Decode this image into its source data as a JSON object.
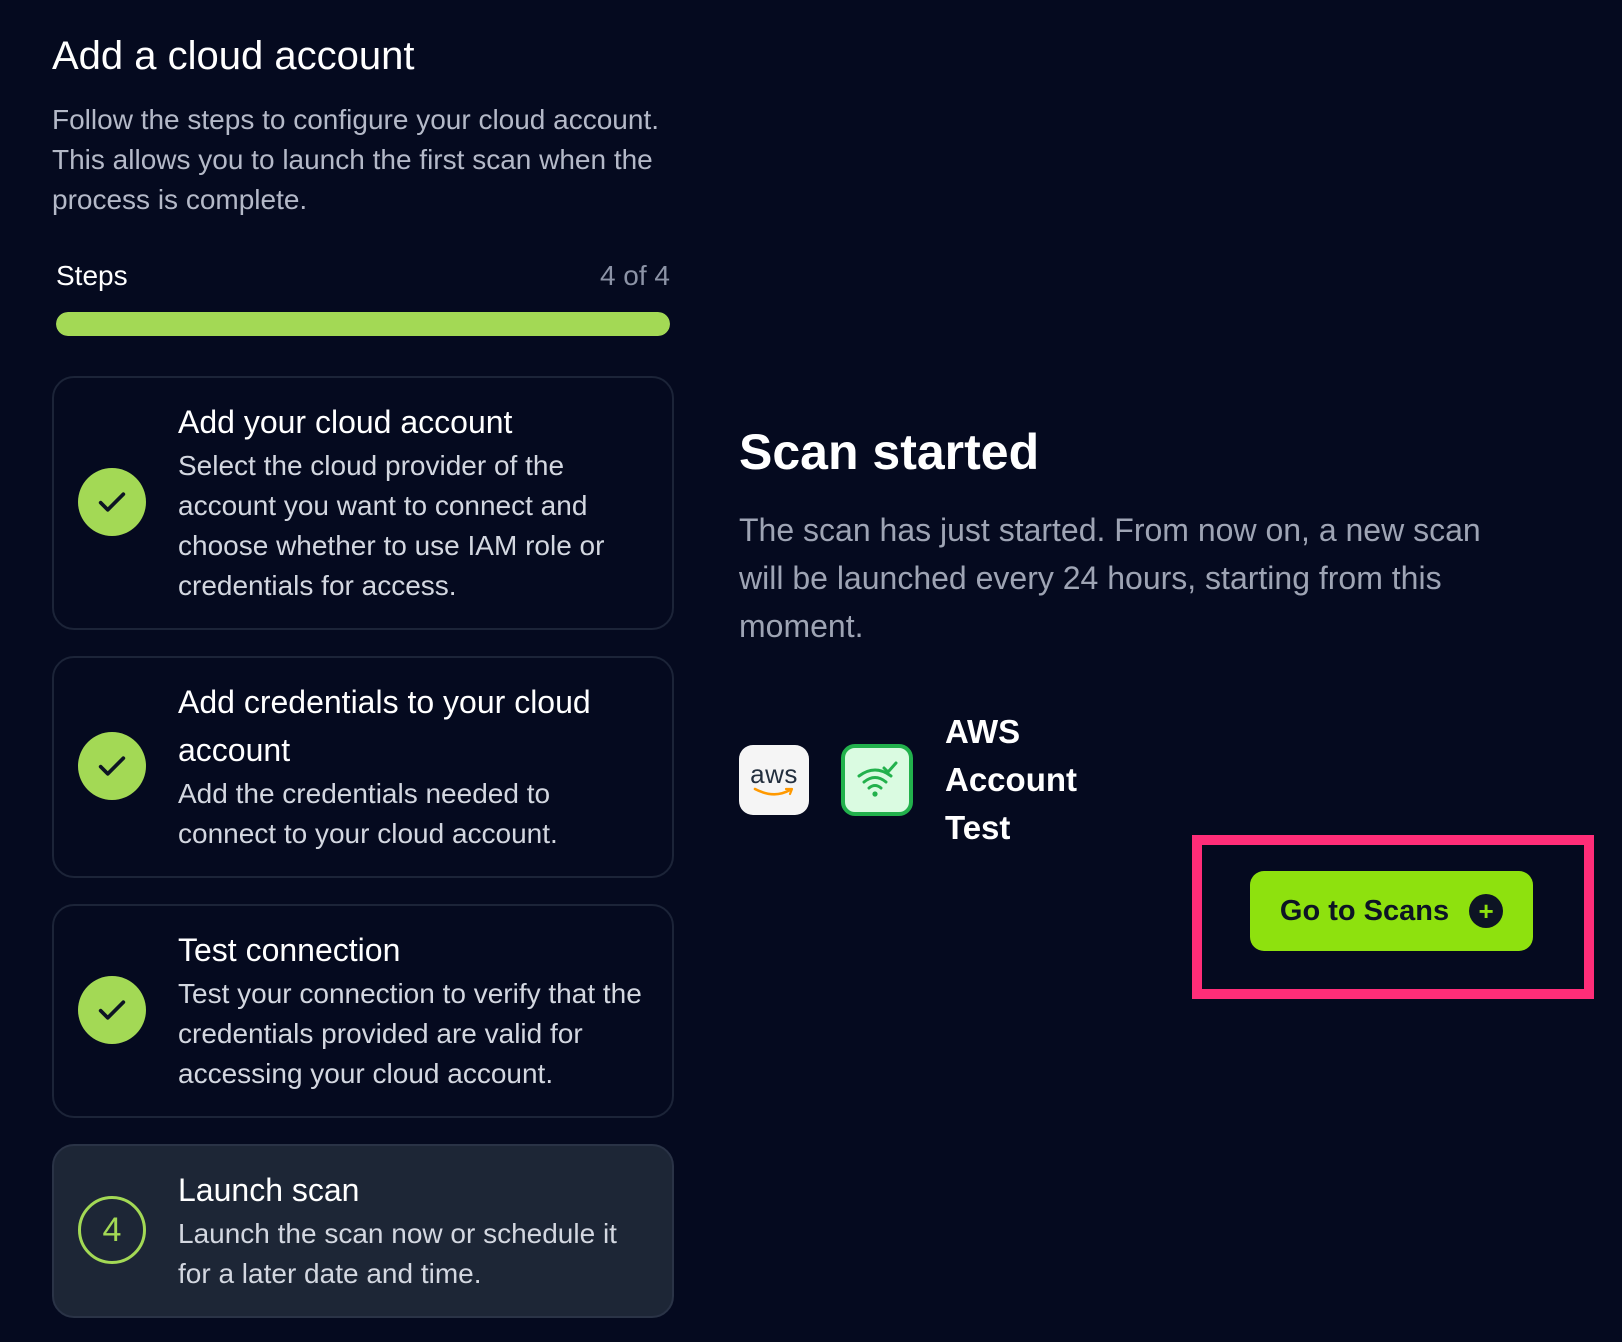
{
  "header": {
    "title": "Add a cloud account",
    "subtitle": "Follow the steps to configure your cloud account. This allows you to launch the first scan when the process is complete."
  },
  "progress": {
    "label": "Steps",
    "count_text": "4 of 4",
    "current": 4,
    "total": 4,
    "fraction": 1.0,
    "color": "#a3d955"
  },
  "steps": [
    {
      "status": "done",
      "icon": "check-icon",
      "title": "Add your cloud account",
      "description": "Select the cloud provider of the account you want to connect and choose whether to use IAM role or credentials for access."
    },
    {
      "status": "done",
      "icon": "check-icon",
      "title": "Add credentials to your cloud account",
      "description": "Add the credentials needed to connect to your cloud account."
    },
    {
      "status": "done",
      "icon": "check-icon",
      "title": "Test connection",
      "description": "Test your connection to verify that the credentials provided are valid for accessing your cloud account."
    },
    {
      "status": "current",
      "number": "4",
      "title": "Launch scan",
      "description": "Launch the scan now or schedule it for a later date and time."
    }
  ],
  "result": {
    "title": "Scan started",
    "description": "The scan has just started. From now on, a new scan will be launched every 24 hours, starting from this moment."
  },
  "account": {
    "provider_logo_text": "aws",
    "provider_icon": "aws-logo-icon",
    "status_icon": "wifi-check-icon",
    "name": "AWS Account Test"
  },
  "cta": {
    "label": "Go to Scans",
    "icon": "plus-circle-icon",
    "color": "#8ee10e",
    "highlight_color": "#ff2d78"
  }
}
